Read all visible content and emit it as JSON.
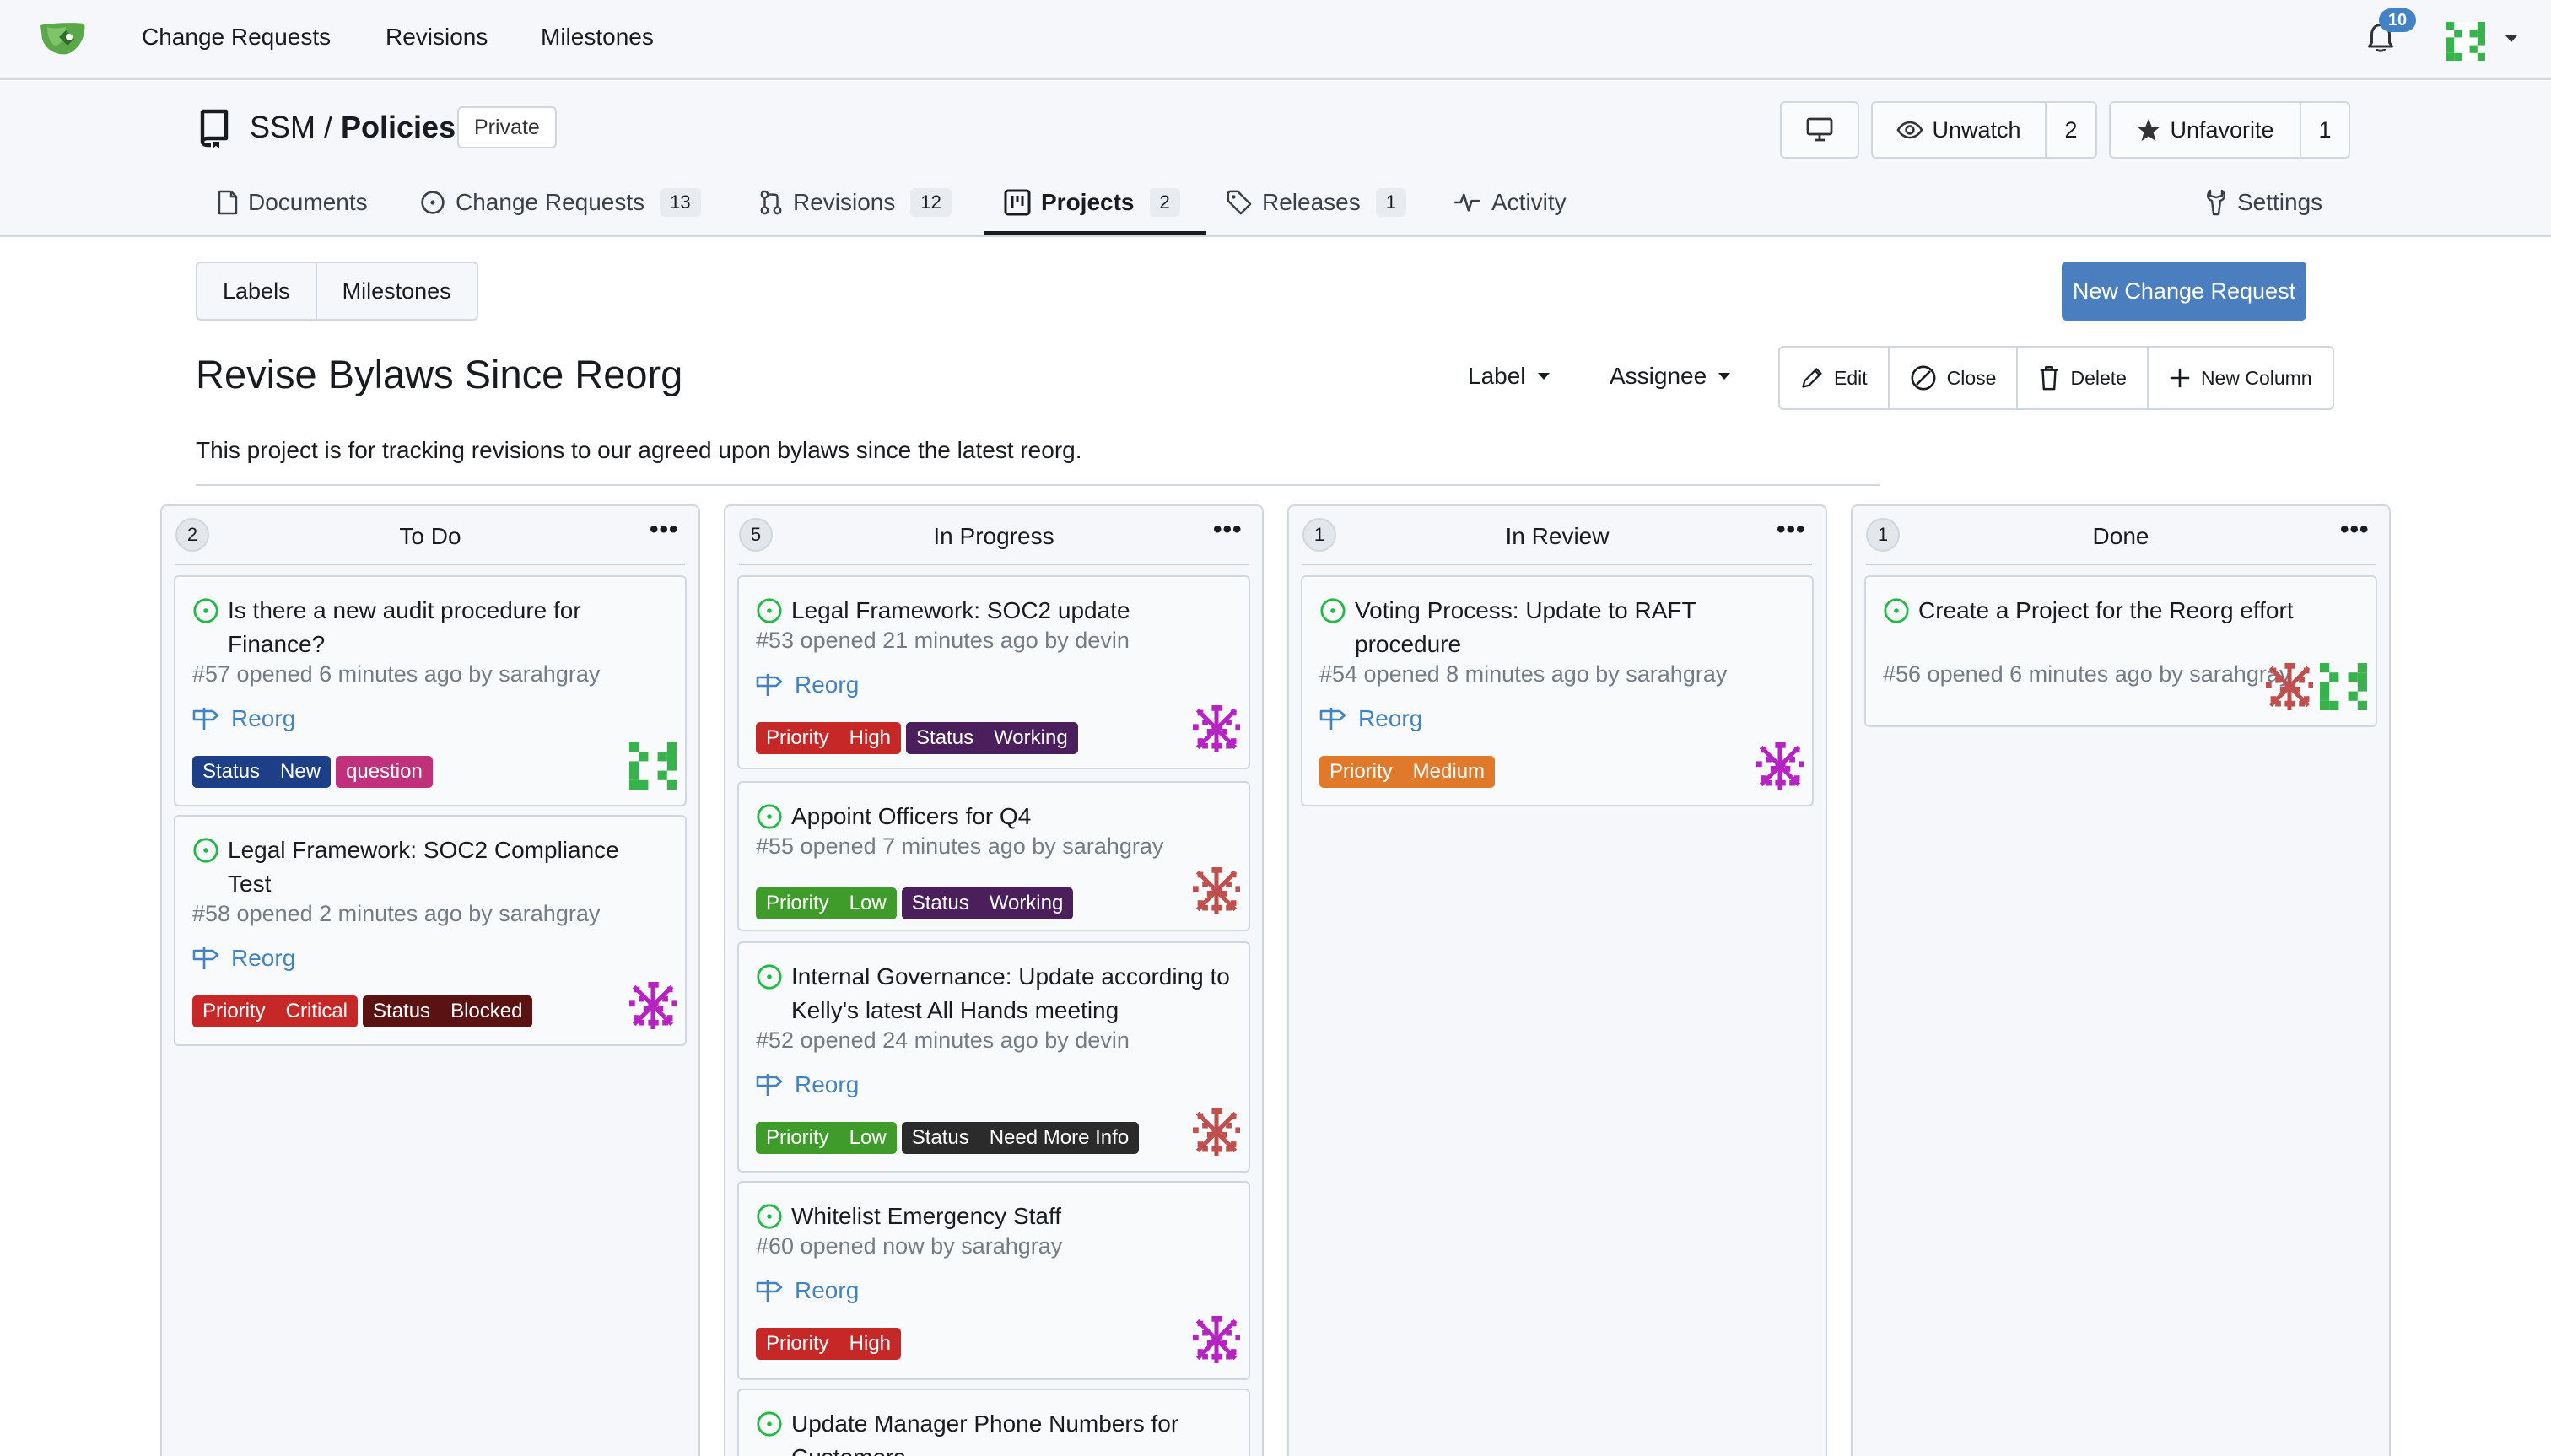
{
  "topnav": {
    "items": [
      "Change Requests",
      "Revisions",
      "Milestones"
    ],
    "notification_count": "10"
  },
  "repo": {
    "owner": "SSM",
    "separator": " / ",
    "name": "Policies",
    "visibility": "Private",
    "unwatch_label": "Unwatch",
    "watch_count": "2",
    "unfavorite_label": "Unfavorite",
    "favorite_count": "1"
  },
  "tabs": [
    {
      "label": "Documents",
      "count": null,
      "icon": "file-icon"
    },
    {
      "label": "Change Requests",
      "count": "13",
      "icon": "issue-icon"
    },
    {
      "label": "Revisions",
      "count": "12",
      "icon": "pull-request-icon"
    },
    {
      "label": "Projects",
      "count": "2",
      "icon": "project-icon",
      "active": true
    },
    {
      "label": "Releases",
      "count": "1",
      "icon": "tag-icon"
    },
    {
      "label": "Activity",
      "count": null,
      "icon": "pulse-icon"
    },
    {
      "label": "Settings",
      "count": null,
      "icon": "tools-icon"
    }
  ],
  "toolbar": {
    "labels_label": "Labels",
    "milestones_label": "Milestones",
    "new_change_request": "New Change Request"
  },
  "project": {
    "title": "Revise Bylaws Since Reorg",
    "description": "This project is for tracking revisions to our agreed upon bylaws since the latest reorg.",
    "label_filter": "Label",
    "assignee_filter": "Assignee",
    "actions": {
      "edit": "Edit",
      "close": "Close",
      "delete": "Delete",
      "new_column": "New Column"
    }
  },
  "colors": {
    "accent": "#4183c4",
    "primary_button": "#4a7ebf",
    "open_icon": "#21ba45",
    "status_blue": "#1d3f87",
    "question": "#c1317b",
    "priority_red": "#c62828",
    "priority_low_green": "#3f9b2a",
    "priority_medium_orange": "#e07a2a",
    "status_working_purple": "#4a1f5c",
    "status_blocked": "#5a1212",
    "status_dark": "#2b2b2b"
  },
  "columns": [
    {
      "title": "To Do",
      "count": "2",
      "cards": [
        {
          "title": "Is there a new audit procedure for Finance?",
          "meta": "#57 opened 6 minutes ago by sarahgray",
          "milestone": "Reorg",
          "labels": [
            {
              "scope": "Status",
              "value": "New",
              "color": "#1d3f87"
            },
            {
              "scope": "",
              "value": "question",
              "color": "#c1317b"
            }
          ],
          "avatars": [
            "green-identicon"
          ]
        },
        {
          "title": "Legal Framework: SOC2 Compliance Test",
          "meta": "#58 opened 2 minutes ago by sarahgray",
          "milestone": "Reorg",
          "labels": [
            {
              "scope": "Priority",
              "value": "Critical",
              "color": "#c62828"
            },
            {
              "scope": "Status",
              "value": "Blocked",
              "color": "#5a1212"
            }
          ],
          "avatars": [
            "purple-identicon"
          ]
        }
      ]
    },
    {
      "title": "In Progress",
      "count": "5",
      "cards": [
        {
          "title": "Legal Framework: SOC2 update",
          "meta": "#53 opened 21 minutes ago by devin",
          "milestone": "Reorg",
          "labels": [
            {
              "scope": "Priority",
              "value": "High",
              "color": "#c62828"
            },
            {
              "scope": "Status",
              "value": "Working",
              "color": "#4a1f5c"
            }
          ],
          "avatars": [
            "purple-identicon"
          ]
        },
        {
          "title": "Appoint Officers for Q4",
          "meta": "#55 opened 7 minutes ago by sarahgray",
          "milestone": "",
          "labels": [
            {
              "scope": "Priority",
              "value": "Low",
              "color": "#3f9b2a"
            },
            {
              "scope": "Status",
              "value": "Working",
              "color": "#4a1f5c"
            }
          ],
          "avatars": [
            "red-identicon"
          ]
        },
        {
          "title": "Internal Governance: Update according to Kelly's latest All Hands meeting",
          "meta": "#52 opened 24 minutes ago by devin",
          "milestone": "Reorg",
          "labels": [
            {
              "scope": "Priority",
              "value": "Low",
              "color": "#3f9b2a"
            },
            {
              "scope": "Status",
              "value": "Need More Info",
              "color": "#2b2b2b"
            }
          ],
          "avatars": [
            "red-identicon"
          ]
        },
        {
          "title": "Whitelist Emergency Staff",
          "meta": "#60 opened now by sarahgray",
          "milestone": "Reorg",
          "labels": [
            {
              "scope": "Priority",
              "value": "High",
              "color": "#c62828"
            }
          ],
          "avatars": [
            "purple-identicon"
          ]
        },
        {
          "title": "Update Manager Phone Numbers for Customers",
          "meta": "",
          "milestone": "",
          "labels": [],
          "avatars": []
        }
      ]
    },
    {
      "title": "In Review",
      "count": "1",
      "cards": [
        {
          "title": "Voting Process: Update to RAFT procedure",
          "meta": "#54 opened 8 minutes ago by sarahgray",
          "milestone": "Reorg",
          "labels": [
            {
              "scope": "Priority",
              "value": "Medium",
              "color": "#e07a2a"
            }
          ],
          "avatars": [
            "purple-identicon"
          ]
        }
      ]
    },
    {
      "title": "Done",
      "count": "1",
      "cards": [
        {
          "title": "Create a Project for the Reorg effort",
          "meta": "#56 opened 6 minutes ago by sarahgray",
          "milestone": "",
          "labels": [],
          "avatars": [
            "red-identicon",
            "green-identicon"
          ]
        }
      ]
    }
  ]
}
